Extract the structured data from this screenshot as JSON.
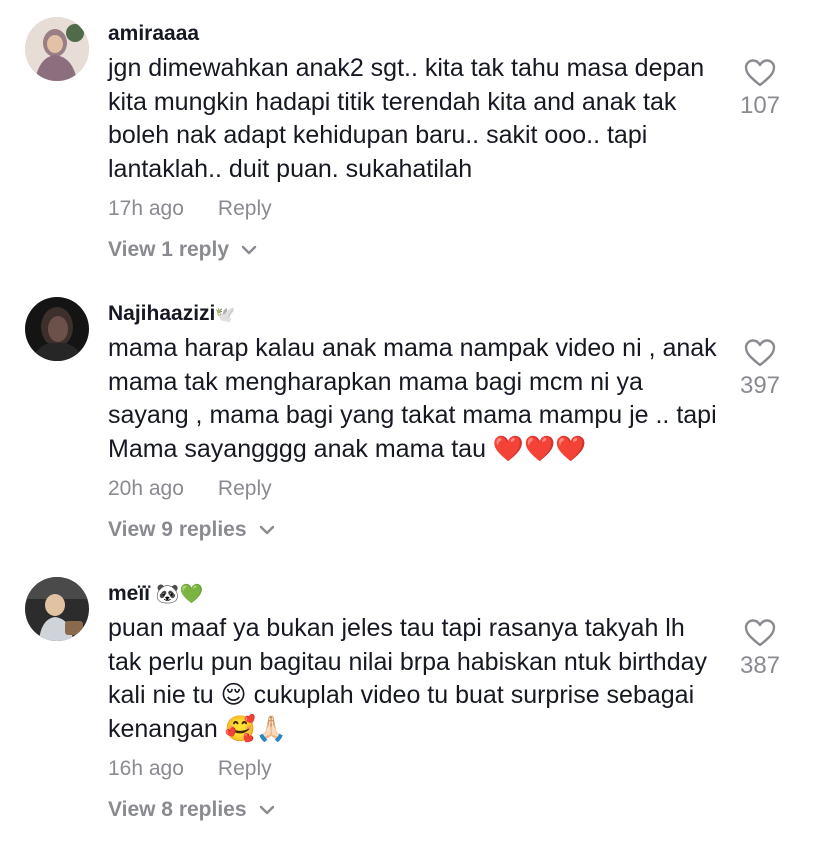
{
  "comments": [
    {
      "username": "amiraaaa",
      "text": "jgn dimewahkan anak2 sgt.. kita tak tahu masa depan kita mungkin hadapi titik terendah kita and anak tak boleh nak adapt kehidupan baru.. sakit ooo.. tapi lantaklah.. duit puan. sukahatilah",
      "time": "17h ago",
      "reply_label": "Reply",
      "view_replies": "View 1 reply",
      "likes": "107",
      "avatar_colors": [
        "#c9a9a6",
        "#7d5c6b"
      ]
    },
    {
      "username": "Najihaazizi",
      "username_emoji": "🕊️",
      "text": "mama harap kalau anak mama nampak video ni , anak mama tak mengharapkan mama bagi mcm ni ya sayang , mama bagi yang takat mama mampu je .. tapi Mama sayangggg anak mama tau ❤️❤️❤️",
      "time": "20h ago",
      "reply_label": "Reply",
      "view_replies": "View 9 replies",
      "likes": "397",
      "avatar_colors": [
        "#1b1b1b",
        "#4a3b36"
      ]
    },
    {
      "username": "meïï",
      "username_emoji": "🐼💚",
      "text": "puan maaf ya bukan jeles tau tapi rasanya takyah lh tak perlu pun bagitau nilai brpa habiskan ntuk birthday kali nie tu 😌 cukuplah video tu buat surprise sebagai kenangan 🥰🙏🏻",
      "time": "16h ago",
      "reply_label": "Reply",
      "view_replies": "View 8 replies",
      "likes": "387",
      "avatar_colors": [
        "#3a3a3a",
        "#d9c3a8"
      ]
    }
  ],
  "icons": {
    "like": "heart-outline-icon",
    "expand": "chevron-down-icon"
  },
  "colors": {
    "text": "#161823",
    "muted": "#8a8b91"
  }
}
